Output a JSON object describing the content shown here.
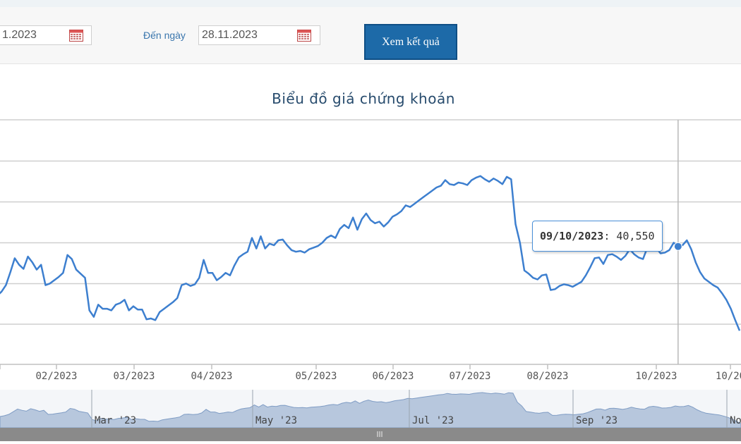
{
  "filter": {
    "from_value": "1.2023",
    "to_label": "Đến ngày",
    "to_value": "28.11.2023",
    "submit_label": "Xem kết quả"
  },
  "icons": {
    "calendar": "calendar-icon"
  },
  "colors": {
    "line": "#3d7fcf",
    "button": "#1d6aa8",
    "navigator_fill": "#b7c7dd",
    "grid": "#cfcfcf"
  },
  "chart_data": {
    "type": "line",
    "title": "Biểu đồ giá chứng khoán",
    "x_start": "2023-01-03",
    "x_end": "2023-10-31",
    "x_tick_labels": [
      "3",
      "02/2023",
      "03/2023",
      "04/2023",
      "05/2023",
      "06/2023",
      "07/2023",
      "08/2023",
      "10/2023",
      "10/20"
    ],
    "navigator_labels": [
      "Mar '23",
      "May '23",
      "Jul '23",
      "Sep '23",
      "No"
    ],
    "y_levels": [
      31000,
      41000
    ],
    "series": [
      {
        "values": [
          34500,
          35000,
          35800,
          37400,
          39100,
          38300,
          37800,
          39300,
          38600,
          37700,
          38300,
          35800,
          36000,
          36400,
          36800,
          37300,
          39500,
          39000,
          37700,
          37200,
          36700,
          32700,
          31900,
          33400,
          32900,
          32900,
          32700,
          33400,
          33600,
          34000,
          32700,
          33200,
          32800,
          32800,
          31600,
          31700,
          31500,
          32500,
          32900,
          33300,
          33700,
          34200,
          35800,
          36000,
          35700,
          35900,
          36700,
          38900,
          37300,
          37300,
          36400,
          36800,
          37300,
          37000,
          38200,
          39200,
          39600,
          39900,
          41600,
          40300,
          41800,
          40300,
          40900,
          40700,
          41300,
          41400,
          40700,
          40100,
          39900,
          40000,
          39800,
          40200,
          40400,
          40600,
          41000,
          41600,
          41900,
          41600,
          42700,
          43200,
          42800,
          44100,
          42600,
          43900,
          44600,
          43800,
          43400,
          43600,
          43000,
          43500,
          44200,
          44500,
          44900,
          45600,
          45400,
          45800,
          46200,
          46600,
          47000,
          47400,
          47800,
          48000,
          48700,
          48200,
          48100,
          48400,
          48300,
          48100,
          48700,
          49000,
          49200,
          48800,
          48500,
          48900,
          48600,
          48200,
          49100,
          48800,
          43300,
          41000,
          37600,
          37200,
          36700,
          36500,
          37000,
          37100,
          35200,
          35300,
          35700,
          35900,
          35800,
          35600,
          35900,
          36200,
          37000,
          38000,
          39100,
          39200,
          38400,
          39500,
          39600,
          39300,
          38900,
          39400,
          40200,
          39600,
          39200,
          39000,
          40400,
          40800,
          40400,
          39700,
          39800,
          40100,
          41000,
          40550,
          40700,
          41300,
          40200,
          38600,
          37400,
          36600,
          36200,
          35800,
          35500,
          34800,
          34000,
          32900,
          31500,
          30200
        ]
      }
    ],
    "highlight": {
      "date": "09/10/2023",
      "value": "40,550"
    }
  }
}
